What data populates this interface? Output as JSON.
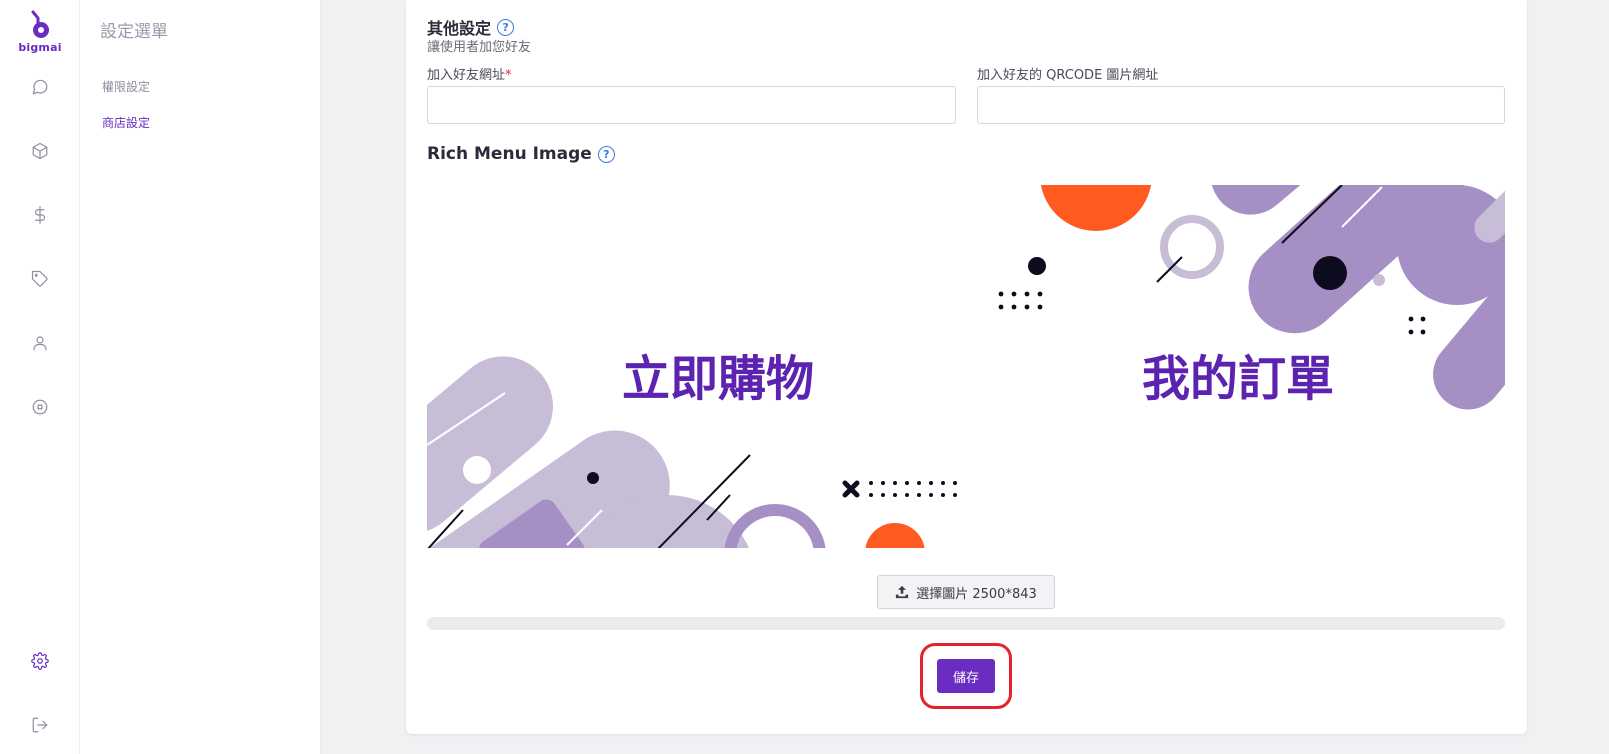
{
  "brand": {
    "name": "bigmai",
    "color": "#6a2cc1"
  },
  "rail": {
    "items": [
      {
        "icon": "chat-icon"
      },
      {
        "icon": "box-icon"
      },
      {
        "icon": "dollar-icon"
      },
      {
        "icon": "tag-icon"
      },
      {
        "icon": "user-icon"
      },
      {
        "icon": "stop-circle-icon"
      },
      {
        "icon": "gear-icon",
        "active": true
      },
      {
        "icon": "logout-icon"
      }
    ]
  },
  "menu": {
    "title": "設定選單",
    "items": [
      {
        "label": "權限設定",
        "active": false
      },
      {
        "label": "商店設定",
        "active": true
      }
    ]
  },
  "other_settings": {
    "title": "其他設定",
    "description": "讓使用者加您好友",
    "add_friend_url": {
      "label": "加入好友網址",
      "required_mark": "*",
      "value": ""
    },
    "qrcode_url": {
      "label": "加入好友的 QRCODE 圖片網址",
      "value": ""
    }
  },
  "rich_menu": {
    "title": "Rich Menu Image",
    "image": {
      "left_text": "立即購物",
      "right_text": "我的訂單"
    },
    "upload_button_label": "選擇圖片 2500*843",
    "progress_percent": 0
  },
  "save_button_label": "儲存",
  "colors": {
    "accent": "#6a2cc1",
    "help": "#3d7bd9",
    "highlight_ring": "#e5212b",
    "image_orange": "#ff5a1f",
    "image_lavender": "#c7bdd6",
    "image_purple": "#a58fc4"
  }
}
